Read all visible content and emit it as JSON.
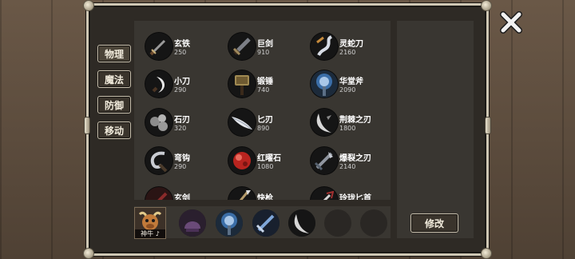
{
  "categories": [
    {
      "label": "物理"
    },
    {
      "label": "魔法"
    },
    {
      "label": "防御"
    },
    {
      "label": "移动"
    }
  ],
  "items": [
    {
      "name": "玄铁",
      "price": "250",
      "icon": "iron-sword-icon"
    },
    {
      "name": "巨剑",
      "price": "910",
      "icon": "greatsword-icon"
    },
    {
      "name": "灵蛇刀",
      "price": "2160",
      "icon": "serpent-blade-icon"
    },
    {
      "name": "小刀",
      "price": "290",
      "icon": "small-knife-icon"
    },
    {
      "name": "锻锤",
      "price": "740",
      "icon": "forge-hammer-icon"
    },
    {
      "name": "华堂斧",
      "price": "2090",
      "icon": "ornate-axe-icon"
    },
    {
      "name": "石刃",
      "price": "320",
      "icon": "stone-blade-icon"
    },
    {
      "name": "匕刃",
      "price": "890",
      "icon": "dagger-blade-icon"
    },
    {
      "name": "荆棘之刃",
      "price": "1800",
      "icon": "thorn-blade-icon"
    },
    {
      "name": "弯钩",
      "price": "290",
      "icon": "hook-icon"
    },
    {
      "name": "红曜石",
      "price": "1080",
      "icon": "red-gem-icon"
    },
    {
      "name": "爆裂之刃",
      "price": "2140",
      "icon": "burst-blade-icon"
    },
    {
      "name": "玄剑",
      "price": "",
      "icon": "dark-sword-icon"
    },
    {
      "name": "快枪",
      "price": "",
      "icon": "quick-spear-icon"
    },
    {
      "name": "玲珑匕首",
      "price": "",
      "icon": "exquisite-dagger-icon"
    }
  ],
  "hero": {
    "label": "神牛 ♪"
  },
  "equipped": [
    {
      "icon": "helmet-icon"
    },
    {
      "icon": "ornate-axe-icon"
    },
    {
      "icon": "greatsword-icon"
    },
    {
      "icon": "dagger-blade-icon"
    },
    {
      "icon": "empty-slot"
    },
    {
      "icon": "empty-slot"
    }
  ],
  "buttons": {
    "modify": "修改"
  },
  "colors": {
    "panel": "#393631",
    "frame": "#cfc7b4",
    "background": "#5a4a3c"
  }
}
